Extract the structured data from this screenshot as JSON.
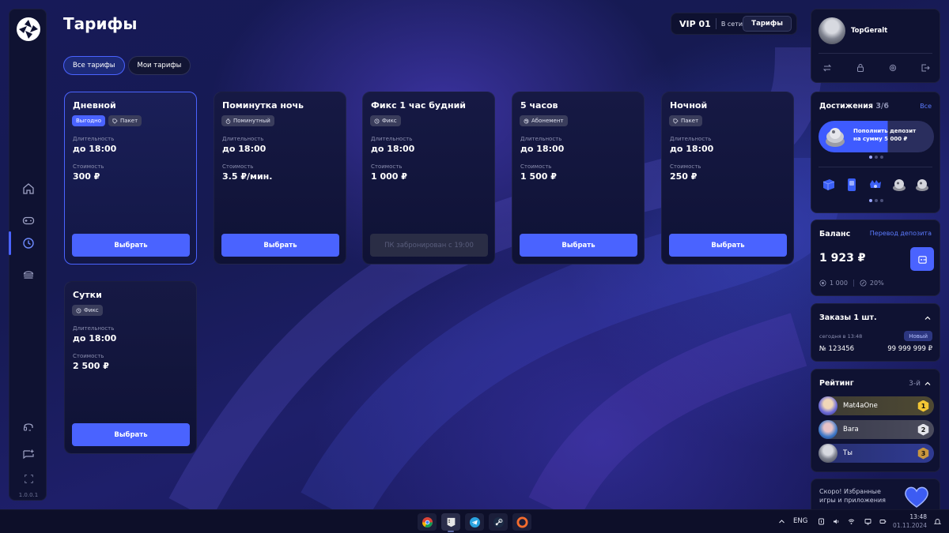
{
  "app": {
    "version": "1.0.0.1"
  },
  "header": {
    "title": "Тарифы",
    "vip": {
      "name": "VIP 01",
      "status": "В сети",
      "tab": "Тарифы"
    }
  },
  "filters": [
    {
      "label": "Все тарифы",
      "active": true
    },
    {
      "label": "Мои тарифы",
      "active": false
    }
  ],
  "tariffs": [
    {
      "title": "Дневной",
      "chips": [
        "Выгодно",
        "Пакет"
      ],
      "duration_label": "Длительность",
      "duration": "до 18:00",
      "price_label": "Стоимость",
      "price": "300 ₽",
      "button": "Выбрать"
    },
    {
      "title": "Поминутка ночь",
      "chips": [
        "Поминутный"
      ],
      "duration_label": "Длительность",
      "duration": "до 18:00",
      "price_label": "Стоимость",
      "price": "3.5 ₽/мин.",
      "button": "Выбрать"
    },
    {
      "title": "Фикс 1 час будний",
      "chips": [
        "Фикс"
      ],
      "duration_label": "Длительность",
      "duration": "до 18:00",
      "price_label": "Стоимость",
      "price": "1 000 ₽",
      "button": "ПК забронирован с 19:00"
    },
    {
      "title": "5 часов",
      "chips": [
        "Абонемент"
      ],
      "duration_label": "Длительность",
      "duration": "до 18:00",
      "price_label": "Стоимость",
      "price": "1 500 ₽",
      "button": "Выбрать"
    },
    {
      "title": "Ночной",
      "chips": [
        "Пакет"
      ],
      "duration_label": "Длительность",
      "duration": "до 18:00",
      "price_label": "Стоимость",
      "price": "250 ₽",
      "button": "Выбрать"
    },
    {
      "title": "Сутки",
      "chips": [
        "Фикс"
      ],
      "duration_label": "Длительность",
      "duration": "до 18:00",
      "price_label": "Стоимость",
      "price": "2 500 ₽",
      "button": "Выбрать"
    }
  ],
  "user": {
    "name": "TopGeralt"
  },
  "achievements": {
    "title": "Достижения",
    "count": "3/6",
    "all_link": "Все",
    "banner": "Пополнить депозит на сумму 5 000 ₽"
  },
  "balance": {
    "title": "Баланс",
    "transfer_link": "Перевод депозита",
    "amount": "1 923 ₽",
    "bonus": "1 000",
    "discount": "20%"
  },
  "orders": {
    "title": "Заказы 1 шт.",
    "time": "сегодня в 13:48",
    "status": "Новый",
    "number": "№ 123456",
    "sum": "99 999 999 ₽"
  },
  "rating": {
    "title": "Рейтинг",
    "rank": "3-й",
    "rows": [
      {
        "name": "Mat4aOne",
        "place": "1"
      },
      {
        "name": "Bara",
        "place": "2"
      },
      {
        "name": "Ты",
        "place": "3"
      }
    ]
  },
  "soon": {
    "text": "Скоро! Избранные игры и приложения"
  },
  "taskbar": {
    "lang": "ENG",
    "time": "13:48",
    "date": "01.11.2024"
  },
  "colors": {
    "accent": "#4a63ff",
    "panel": "#0f1232"
  }
}
